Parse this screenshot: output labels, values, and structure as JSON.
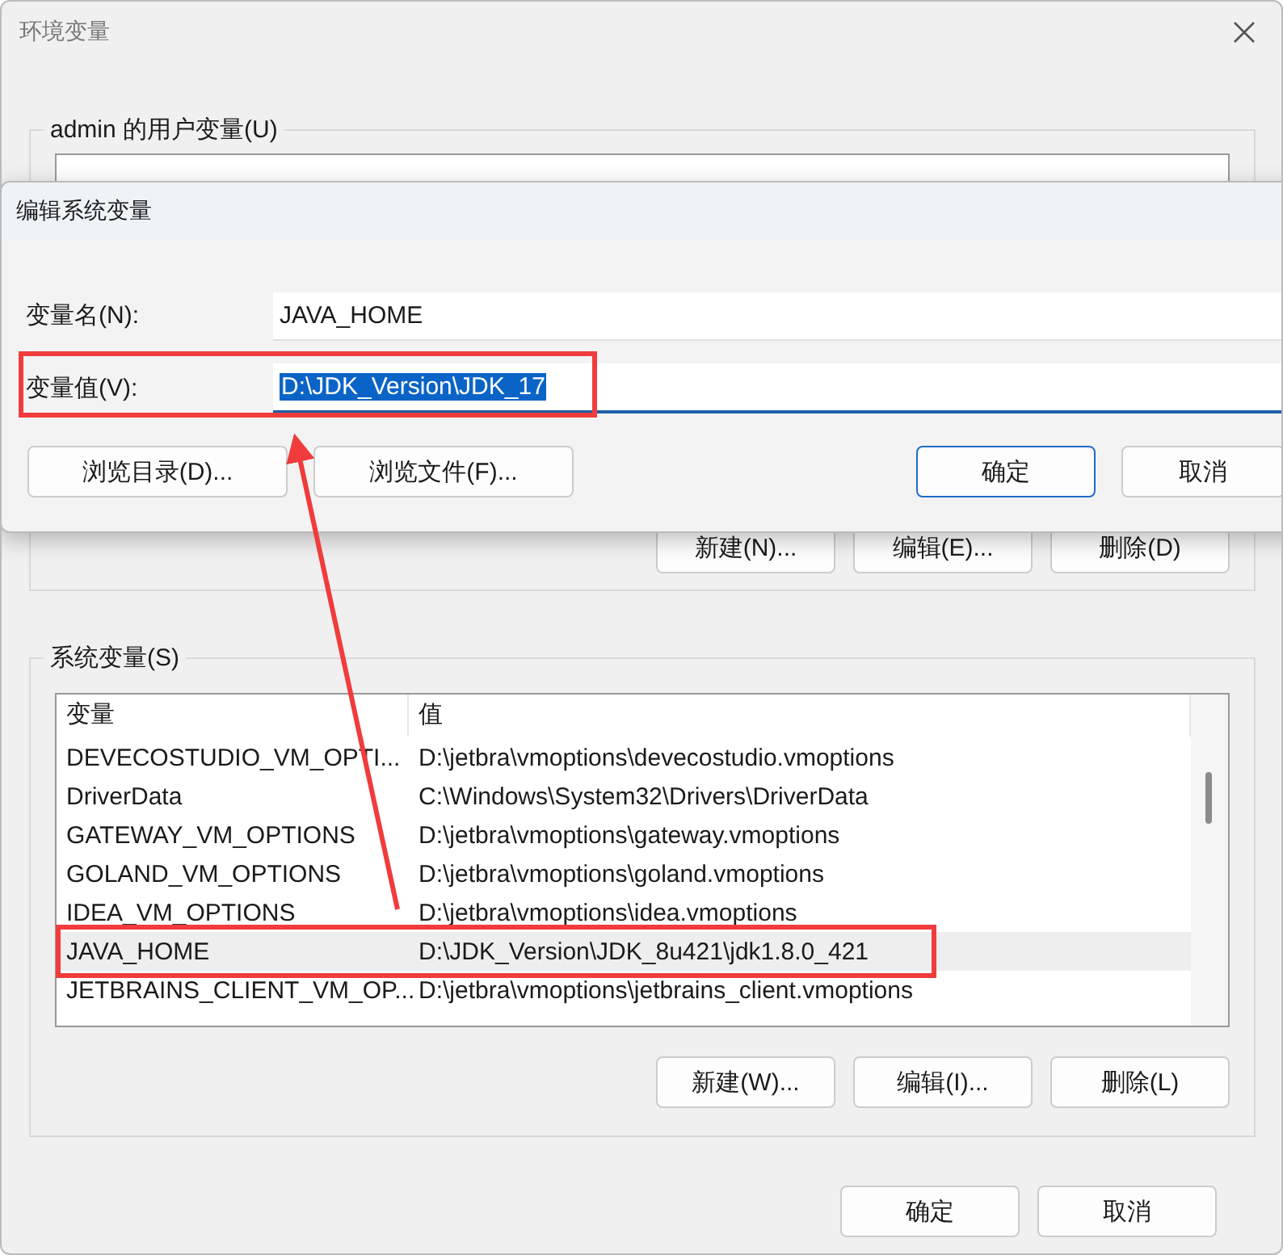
{
  "window": {
    "title": "环境变量"
  },
  "user_variables": {
    "label": "admin 的用户变量(U)",
    "buttons": [
      "新建(N)...",
      "编辑(E)...",
      "删除(D)"
    ]
  },
  "system_variables": {
    "label": "系统变量(S)",
    "columns": [
      "变量",
      "值"
    ],
    "rows": [
      {
        "name": "DEVECOSTUDIO_VM_OPTI...",
        "value": "D:\\jetbra\\vmoptions\\devecostudio.vmoptions",
        "selected": false
      },
      {
        "name": "DriverData",
        "value": "C:\\Windows\\System32\\Drivers\\DriverData",
        "selected": false
      },
      {
        "name": "GATEWAY_VM_OPTIONS",
        "value": "D:\\jetbra\\vmoptions\\gateway.vmoptions",
        "selected": false
      },
      {
        "name": "GOLAND_VM_OPTIONS",
        "value": "D:\\jetbra\\vmoptions\\goland.vmoptions",
        "selected": false
      },
      {
        "name": "IDEA_VM_OPTIONS",
        "value": "D:\\jetbra\\vmoptions\\idea.vmoptions",
        "selected": false
      },
      {
        "name": "JAVA_HOME",
        "value": "D:\\JDK_Version\\JDK_8u421\\jdk1.8.0_421",
        "selected": true
      },
      {
        "name": "JETBRAINS_CLIENT_VM_OP...",
        "value": "D:\\jetbra\\vmoptions\\jetbrains_client.vmoptions",
        "selected": false
      }
    ],
    "buttons": [
      "新建(W)...",
      "编辑(I)...",
      "删除(L)"
    ]
  },
  "buttons": [
    "确定",
    "取消"
  ],
  "edit_dialog": {
    "title": "编辑系统变量",
    "fields": [
      {
        "label": "变量名(N):",
        "value": "JAVA_HOME",
        "focused": false
      },
      {
        "label": "变量值(V):",
        "value": "D:\\JDK_Version\\JDK_17",
        "focused": true
      }
    ],
    "buttons": [
      {
        "label": "浏览目录(D)...",
        "default": false
      },
      {
        "label": "浏览文件(F)...",
        "default": false
      },
      {
        "label": "确定",
        "default": true
      },
      {
        "label": "取消",
        "default": false
      }
    ]
  }
}
